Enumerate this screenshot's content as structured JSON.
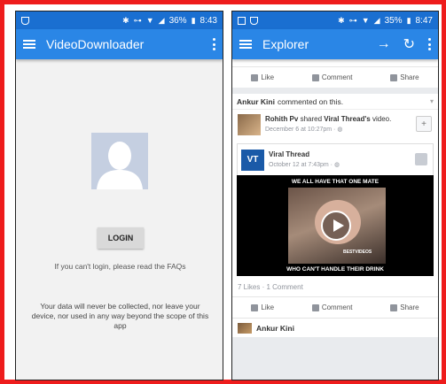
{
  "colors": {
    "frame": "#ee1c1c",
    "status_bar": "#1a6fd1",
    "app_bar": "#2a86e6"
  },
  "left": {
    "status": {
      "battery": "36%",
      "time": "8:43"
    },
    "title": "VideoDownloader",
    "login_label": "LOGIN",
    "hint": "If you can't login, please read the FAQs",
    "privacy": "Your data will never be collected, nor leave your device, nor used in any way beyond the scope of this app"
  },
  "right": {
    "status": {
      "battery": "35%",
      "time": "8:47"
    },
    "title": "Explorer",
    "actions": {
      "like": "Like",
      "comment": "Comment",
      "share": "Share"
    },
    "activity": {
      "name": "Ankur Kini",
      "text": "commented on this."
    },
    "post": {
      "author": "Rohith Pv",
      "shared": "shared",
      "page": "Viral Thread's",
      "object": "video.",
      "date": "December 6 at 10:27pm · "
    },
    "shared_page": {
      "logo": "VT",
      "name": "Viral Thread",
      "date": "October 12 at 7:43pm · "
    },
    "video": {
      "top_caption": "WE ALL HAVE THAT ONE MATE",
      "bottom_caption": "WHO CAN'T HANDLE THEIR DRINK",
      "watermark": "BESTVIDEOS"
    },
    "stats": "7 Likes · 1 Comment",
    "commenter": "Ankur Kini"
  }
}
